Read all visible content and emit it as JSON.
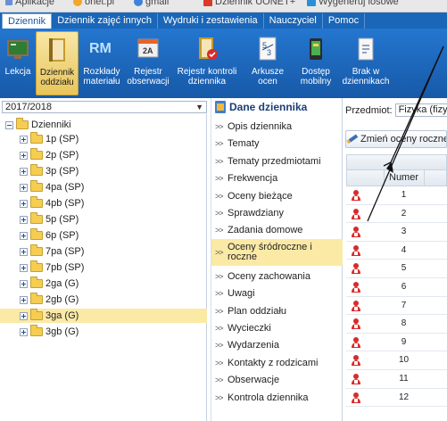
{
  "browser": {
    "bookmarks": [
      "Aplikacje",
      "onet.pl",
      "gmail",
      "Dziennik UONET+",
      "Wygeneruj losowe"
    ]
  },
  "menu": {
    "tabs": [
      "Dziennik",
      "Dziennik zajęć innych",
      "Wydruki i zestawienia",
      "Nauczyciel",
      "Pomoc"
    ],
    "active_tab": "Dziennik"
  },
  "ribbon": {
    "buttons": [
      {
        "label": "Lekcja",
        "icon": "lesson-icon"
      },
      {
        "label": "Dziennik oddziału",
        "icon": "journal-icon",
        "active": true
      },
      {
        "label": "Rozkłady materiału",
        "icon": "rm-icon"
      },
      {
        "label": "Rejestr obserwacji",
        "icon": "observation-icon"
      },
      {
        "label": "Rejestr kontroli dziennika",
        "icon": "control-icon"
      },
      {
        "label": "Arkusze ocen",
        "icon": "sheet-icon"
      },
      {
        "label": "Dostęp mobilny",
        "icon": "mobile-icon"
      },
      {
        "label": "Brak w dziennikach",
        "icon": "missing-icon"
      }
    ],
    "rm_text": "RM",
    "reg_text": "2A"
  },
  "year": {
    "selected": "2017/2018"
  },
  "tree": {
    "root": "Dzienniki",
    "items": [
      "1p (SP)",
      "2p (SP)",
      "3p (SP)",
      "4pa (SP)",
      "4pb (SP)",
      "5p (SP)",
      "6p (SP)",
      "7pa (SP)",
      "7pb (SP)",
      "2ga (G)",
      "2gb (G)",
      "3ga (G)",
      "3gb (G)"
    ],
    "selected": "3ga (G)"
  },
  "dane": {
    "title": "Dane dziennika",
    "items": [
      "Opis dziennika",
      "Tematy",
      "Tematy przedmiotami",
      "Frekwencja",
      "Oceny bieżące",
      "Sprawdziany",
      "Zadania domowe",
      "Oceny śródroczne i roczne",
      "Oceny zachowania",
      "Uwagi",
      "Plan oddziału",
      "Wycieczki",
      "Wydarzenia",
      "Kontakty z rodzicami",
      "Obserwacje",
      "Kontrola dziennika"
    ],
    "selected": "Oceny śródroczne i roczne"
  },
  "right": {
    "subject_label": "Przedmiot:",
    "subject_value": "Fizyka (fizyk",
    "change_button": "Zmień oceny roczne",
    "column_number": "Numer",
    "rows": [
      "1",
      "2",
      "3",
      "4",
      "5",
      "6",
      "7",
      "8",
      "9",
      "10",
      "11",
      "12"
    ]
  },
  "colors": {
    "menu_blue": "#1a66b8",
    "ribbon_blue": "#1e6bc0",
    "selection": "#fbe9a6",
    "student_icon": "#d92a2a"
  }
}
